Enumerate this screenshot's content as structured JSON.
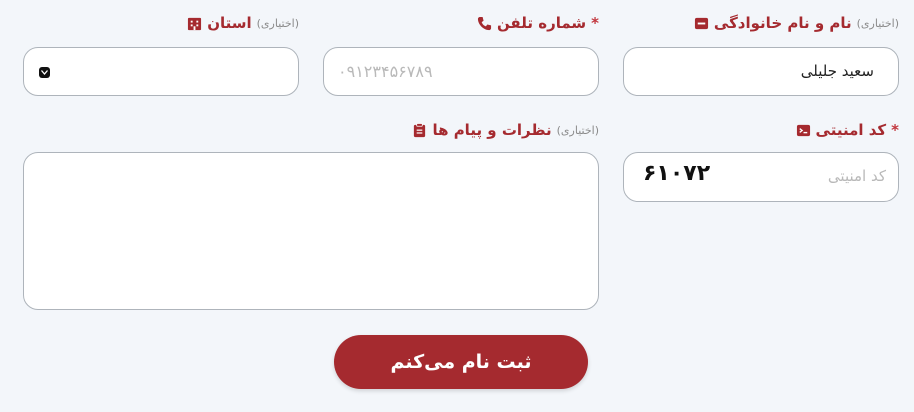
{
  "fields": {
    "name": {
      "label": "نام و نام خانوادگی",
      "optional": "(اختیاری)",
      "value": "سعید جلیلی"
    },
    "phone": {
      "label": "شماره تلفن",
      "required": "*",
      "placeholder": "۰۹۱۲۳۴۵۶۷۸۹"
    },
    "province": {
      "label": "استان",
      "optional": "(اختیاری)"
    },
    "captcha": {
      "label": "کد امنیتی",
      "required": "*",
      "placeholder": "کد امنیتی",
      "code": "۶۱۰۷۲"
    },
    "comments": {
      "label": "نظرات و پیام ها",
      "optional": "(اختیاری)"
    }
  },
  "submit_label": "ثبت نام می‌کنم",
  "colors": {
    "accent": "#a52a2f",
    "background": "#f3f6fa",
    "border": "#aeb4bb"
  }
}
